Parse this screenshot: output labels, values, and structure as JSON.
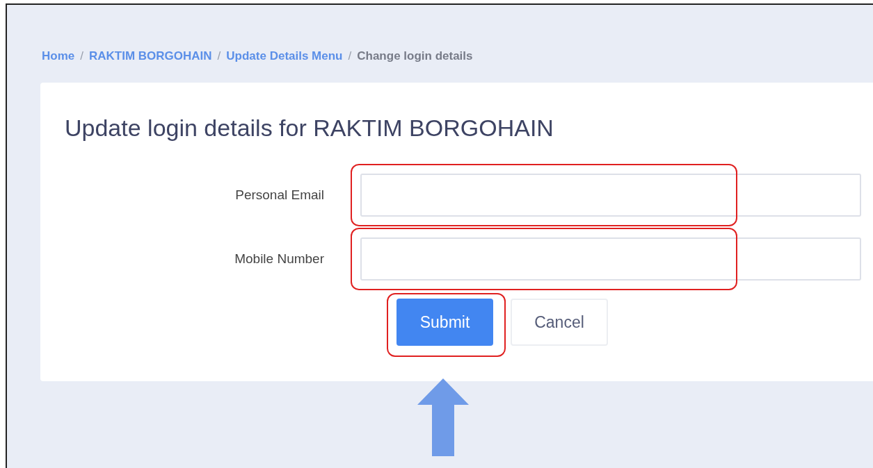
{
  "breadcrumb": {
    "separator": "/",
    "items": [
      {
        "label": "Home",
        "kind": "link"
      },
      {
        "label": "RAKTIM BORGOHAIN",
        "kind": "link"
      },
      {
        "label": "Update Details Menu",
        "kind": "link"
      },
      {
        "label": "Change login details",
        "kind": "current"
      }
    ]
  },
  "form": {
    "title": "Update login details for RAKTIM BORGOHAIN",
    "fields": [
      {
        "label": "Personal Email",
        "highlighted": true
      },
      {
        "label": "Mobile Number",
        "highlighted": true
      }
    ],
    "buttons": [
      {
        "label": "Submit",
        "kind": "primary",
        "highlighted": true
      },
      {
        "label": "Cancel",
        "kind": "secondary",
        "highlighted": false
      }
    ]
  }
}
